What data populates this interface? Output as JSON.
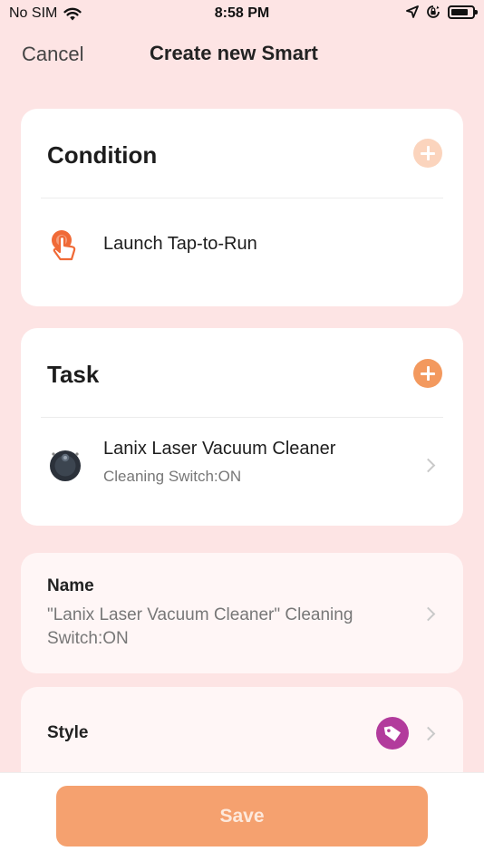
{
  "status_bar": {
    "carrier": "No SIM",
    "time": "8:58 PM",
    "icons": [
      "wifi-icon",
      "location-arrow-icon",
      "orientation-lock-icon",
      "battery-icon"
    ]
  },
  "nav": {
    "cancel_label": "Cancel",
    "title": "Create new Smart"
  },
  "condition": {
    "title": "Condition",
    "add_icon": "plus-circle-icon",
    "items": [
      {
        "label": "Launch Tap-to-Run",
        "icon": "tap-hand-icon"
      }
    ]
  },
  "task": {
    "title": "Task",
    "add_icon": "plus-circle-icon",
    "items": [
      {
        "label": "Lanix Laser Vacuum Cleaner",
        "sublabel": "Cleaning Switch:ON",
        "icon": "robot-vacuum-icon"
      }
    ]
  },
  "name": {
    "label": "Name",
    "value": "\"Lanix Laser Vacuum Cleaner\" Cleaning Switch:ON"
  },
  "style": {
    "label": "Style",
    "icon": "tag-icon"
  },
  "footer": {
    "save_label": "Save"
  },
  "colors": {
    "background": "#fde4e4",
    "accent_orange": "#f3995e",
    "save_button": "#f5a16f",
    "style_badge": "#b23b9c"
  }
}
